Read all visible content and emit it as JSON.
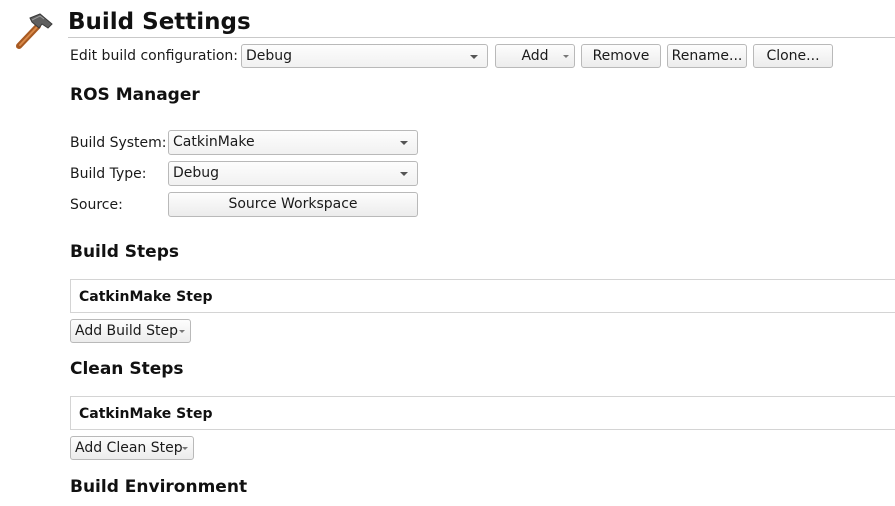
{
  "header": {
    "title": "Build Settings",
    "icon": "hammer-icon"
  },
  "config": {
    "label": "Edit build configuration:",
    "selected": "Debug",
    "add_label": "Add",
    "remove_label": "Remove",
    "rename_label": "Rename...",
    "clone_label": "Clone..."
  },
  "ros_manager": {
    "heading": "ROS Manager",
    "build_system_label": "Build System:",
    "build_system_value": "CatkinMake",
    "build_type_label": "Build Type:",
    "build_type_value": "Debug",
    "source_label": "Source:",
    "source_button": "Source Workspace"
  },
  "build_steps": {
    "heading": "Build Steps",
    "step_title": "CatkinMake Step",
    "add_label": "Add Build Step"
  },
  "clean_steps": {
    "heading": "Clean Steps",
    "step_title": "CatkinMake Step",
    "add_label": "Add Clean Step"
  },
  "build_environment": {
    "heading": "Build Environment"
  },
  "colors": {
    "border": "#b9b9b9",
    "panel_border": "#d4d4d4",
    "hammer_head": "#6b6b6b",
    "hammer_handle": "#c26a2a"
  }
}
